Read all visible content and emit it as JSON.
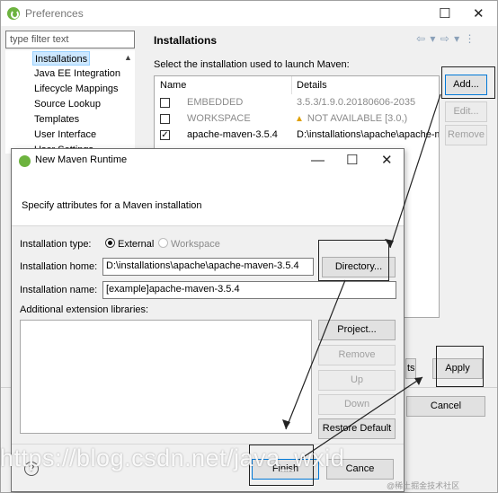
{
  "preferences": {
    "title": "Preferences",
    "filter_placeholder": "type filter text",
    "tree_items": [
      "Installations",
      "Java EE Integration",
      "Lifecycle Mappings",
      "Source Lookup",
      "Templates",
      "User Interface",
      "User Settings"
    ],
    "pane_title": "Installations",
    "subtitle": "Select the installation used to launch Maven:",
    "columns": {
      "name": "Name",
      "details": "Details"
    },
    "rows": [
      {
        "name": "EMBEDDED",
        "details": "3.5.3/1.9.0.20180606-2035",
        "checked": false,
        "muted": true,
        "warn": false
      },
      {
        "name": "WORKSPACE",
        "details": "NOT AVAILABLE [3.0,)",
        "checked": false,
        "muted": true,
        "warn": true
      },
      {
        "name": "apache-maven-3.5.4",
        "details": "D:\\installations\\apache\\apache-maven-3.5.4",
        "checked": true,
        "muted": false,
        "warn": false
      }
    ],
    "buttons": {
      "add": "Add...",
      "edit": "Edit...",
      "remove": "Remove",
      "apply": "Apply",
      "cancel": "Cancel",
      "apply_close_partial": "ts"
    },
    "window_controls": {
      "maximize": "☐",
      "close": "✕"
    }
  },
  "dialog": {
    "title": "New Maven Runtime",
    "subtitle": "Specify attributes for a Maven installation",
    "type_label": "Installation type:",
    "type_external": "External",
    "type_workspace": "Workspace",
    "home_label": "Installation home:",
    "home_value": "D:\\installations\\apache\\apache-maven-3.5.4",
    "name_label": "Installation name:",
    "name_value": "[example]apache-maven-3.5.4",
    "libs_label": "Additional extension libraries:",
    "buttons": {
      "directory": "Directory...",
      "project": "Project...",
      "remove": "Remove",
      "up": "Up",
      "down": "Down",
      "restore": "Restore Default",
      "finish": "Finish",
      "cancel": "Cance"
    },
    "help": "?",
    "window_controls": {
      "minimize": "—",
      "maximize": "☐",
      "close": "✕"
    }
  },
  "watermark": {
    "text": "https://blog.csdn.net/java_wxid",
    "credit": "@稀土掘金技术社区"
  }
}
